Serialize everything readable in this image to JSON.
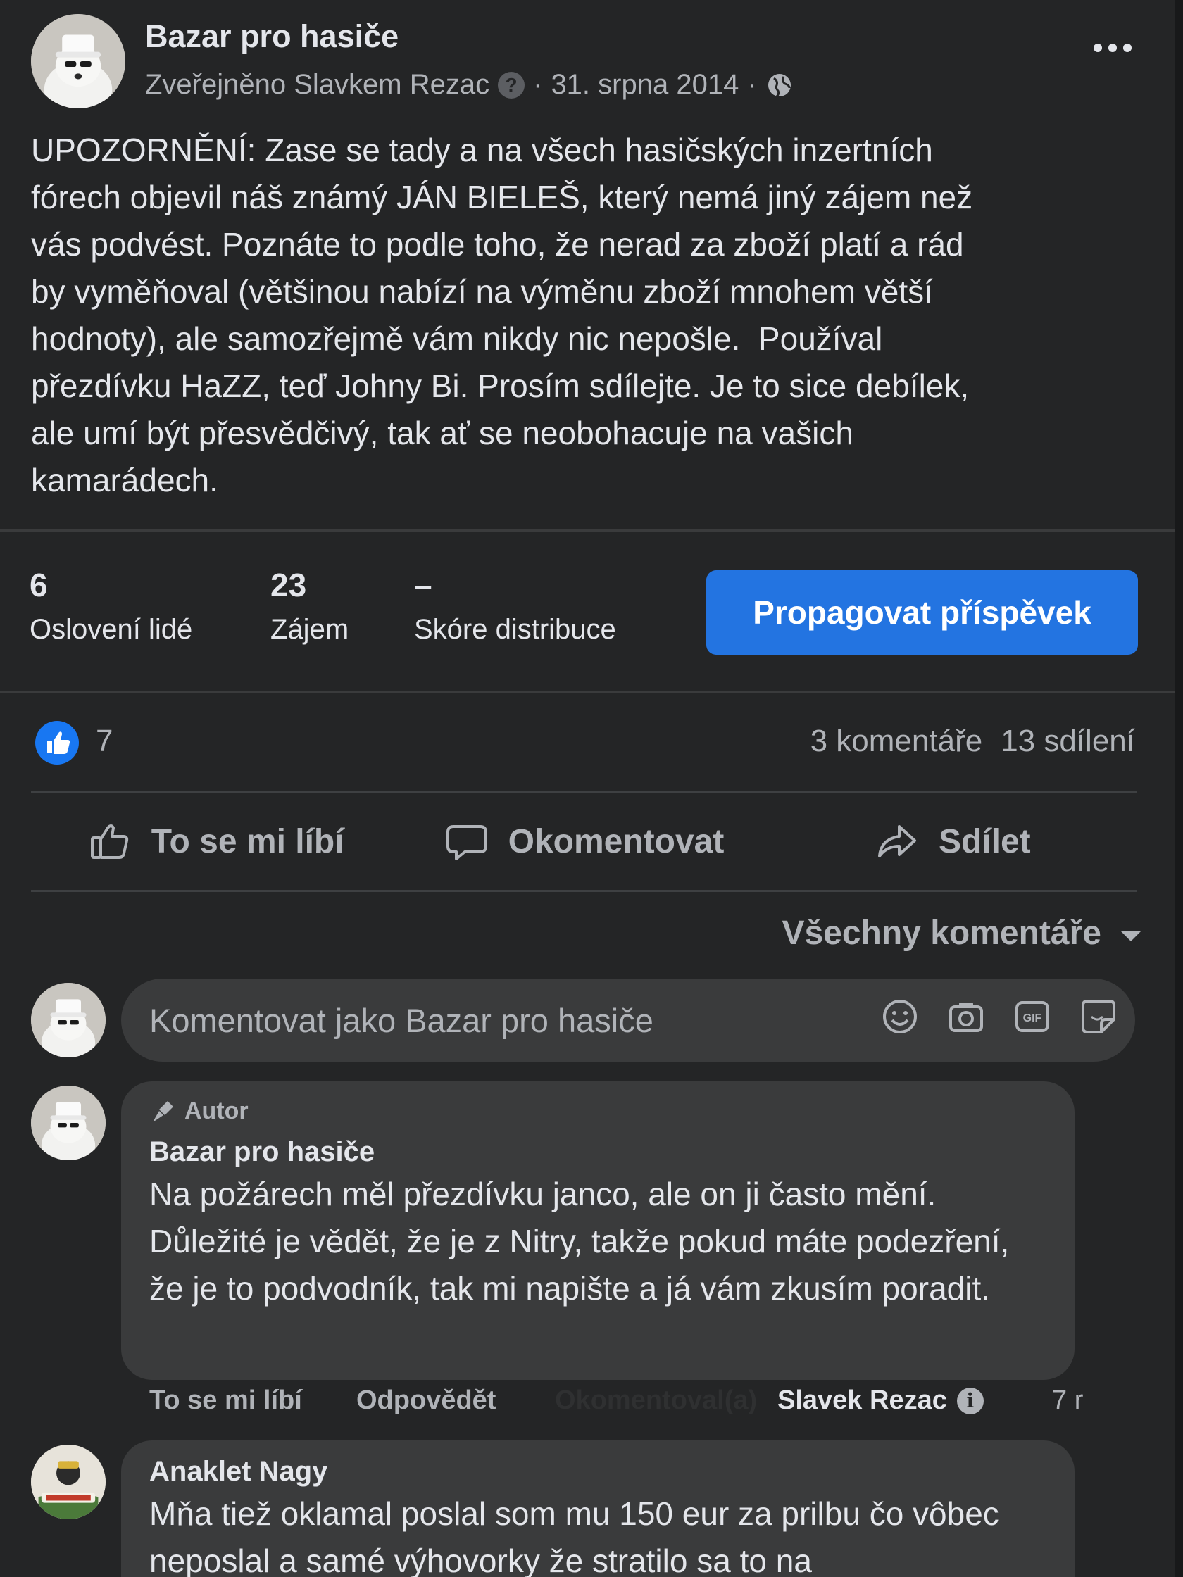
{
  "post": {
    "page_name": "Bazar pro hasiče",
    "byline_prefix": "Zveřejněno Slavkem Rezac",
    "help_icon": "?",
    "separator": "·",
    "date": "31. srpna 2014",
    "privacy_icon": "globe-icon",
    "body": "UPOZORNĚNÍ: Zase se tady a na všech hasičských inzertních\nfórech objevil náš známý JÁN BIELEŠ, který nemá jiný zájem než\nvás podvést. Poznáte to podle toho, že nerad za zboží platí a rád\nby vyměňoval (většinou nabízí na výměnu zboží mnohem větší\nhodnoty), ale samozřejmě vám nikdy nic nepošle.  Používal\npřezdívku HaZZ, teď Johny Bi. Prosím sdílejte. Je to sice debílek,\nale umí být přesvědčivý, tak ať se neobohacuje na vašich\nkamarádech."
  },
  "insights": {
    "reached_value": "6",
    "reached_label": "Oslovení lidé",
    "engagement_value": "23",
    "engagement_label": "Zájem",
    "distribution_value": "–",
    "distribution_label": "Skóre distribuce",
    "boost_label": "Propagovat příspěvek"
  },
  "reactions": {
    "like_count": "7",
    "comments_count": "3 komentáře",
    "shares_count": "13 sdílení"
  },
  "actions": {
    "like": "To se mi líbí",
    "comment": "Okomentovat",
    "share": "Sdílet"
  },
  "sort": {
    "label": "Všechny komentáře"
  },
  "composer": {
    "placeholder": "Komentovat jako Bazar pro hasiče",
    "icons": [
      "emoji-icon",
      "camera-icon",
      "gif-icon",
      "sticker-icon"
    ]
  },
  "comments": [
    {
      "badge": "Autor",
      "name": "Bazar pro hasiče",
      "text": "Na požárech měl přezdívku janco, ale on ji často mění. Důležité je vědět, že je z Nitry, takže pokud máte podezření, že je to podvodník, tak mi napište a já vám zkusím poradit.",
      "like": "To se mi líbí",
      "reply": "Odpovědět",
      "ghost": "Okomentoval(a)",
      "commenter": "Slavek Rezac",
      "info_icon": "i",
      "age": "7 r"
    },
    {
      "name": "Anaklet Nagy",
      "text": "Mňa tiež oklamal poslal som mu 150 eur za prilbu čo vôbec neposlal a samé výhovorky že stratilo sa to na"
    }
  ],
  "colors": {
    "background": "#242526",
    "bubble": "#3a3b3c",
    "accent": "#2374e1",
    "text_primary": "#e4e6eb",
    "text_secondary": "#b0b3b8"
  }
}
